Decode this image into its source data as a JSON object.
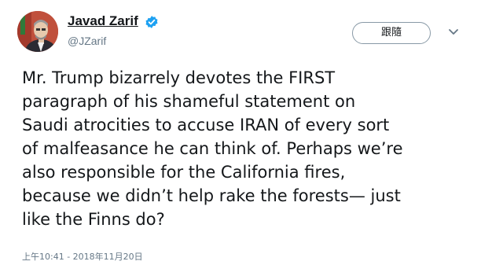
{
  "tweet": {
    "author": {
      "name": "Javad Zarif",
      "handle": "@JZarif",
      "verified": true,
      "avatar_icon": "profile-photo-icon"
    },
    "follow_button_label": "跟隨",
    "menu_icon": "chevron-down-icon",
    "text_lines": [
      "Mr. Trump bizarrely devotes the FIRST",
      "paragraph of his shameful statement on",
      "Saudi atrocities to accuse IRAN of every sort",
      "of malfeasance he can think of. Perhaps we’re",
      "also responsible for the California fires,",
      "because we didn’t help rake the forests— just",
      "like the Finns do?"
    ],
    "timestamp": "上午10:41 - 2018年11月20日"
  },
  "colors": {
    "text_primary": "#14171a",
    "text_secondary": "#657786",
    "verified_badge": "#1da1f2",
    "button_border": "#8899a6"
  }
}
